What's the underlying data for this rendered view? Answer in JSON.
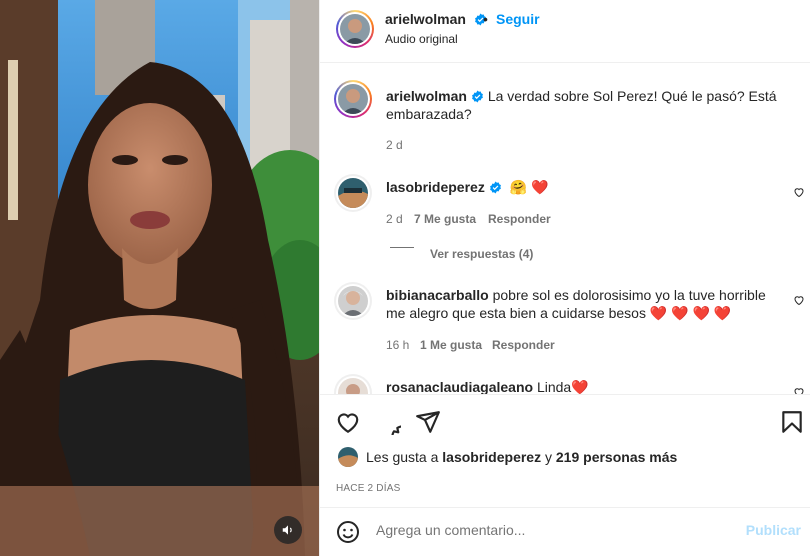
{
  "post": {
    "username": "arielwolman",
    "follow_label": "Seguir",
    "audio_label": "Audio original"
  },
  "caption": {
    "username": "arielwolman",
    "text": "La verdad sobre Sol Perez! Qué le pasó? Está embarazada?",
    "age": "2 d"
  },
  "comments": [
    {
      "username": "lasobrideperez",
      "text": "🤗 ❤️",
      "age": "2 d",
      "likes": "7 Me gusta",
      "reply_label": "Responder",
      "view_replies": "Ver respuestas (4)"
    },
    {
      "username": "bibianacarballo",
      "text": "pobre sol es dolorosisimo yo la tuve horrible me alegro que esta bien a cuidarse besos ❤️ ❤️ ❤️ ❤️",
      "age": "16 h",
      "likes": "1 Me gusta",
      "reply_label": "Responder"
    },
    {
      "username": "rosanaclaudiagaleano",
      "text": "Linda❤️"
    }
  ],
  "likes": {
    "prefix": "Les gusta a",
    "user": "lasobrideperez",
    "joiner": "y",
    "others": "219 personas más"
  },
  "timestamp": "HACE 2 DÍAS",
  "composer": {
    "placeholder": "Agrega un comentario...",
    "post_label": "Publicar"
  },
  "icons": {
    "verified": "verified-badge-icon",
    "like": "heart-icon",
    "comment": "comment-icon",
    "share": "paper-plane-icon",
    "save": "bookmark-icon",
    "emoji": "emoji-icon",
    "sound": "speaker-icon"
  },
  "colors": {
    "accent": "#0095f6",
    "verified": "#0095f6",
    "muted": "#737373",
    "post_disabled": "#b2dffc"
  }
}
